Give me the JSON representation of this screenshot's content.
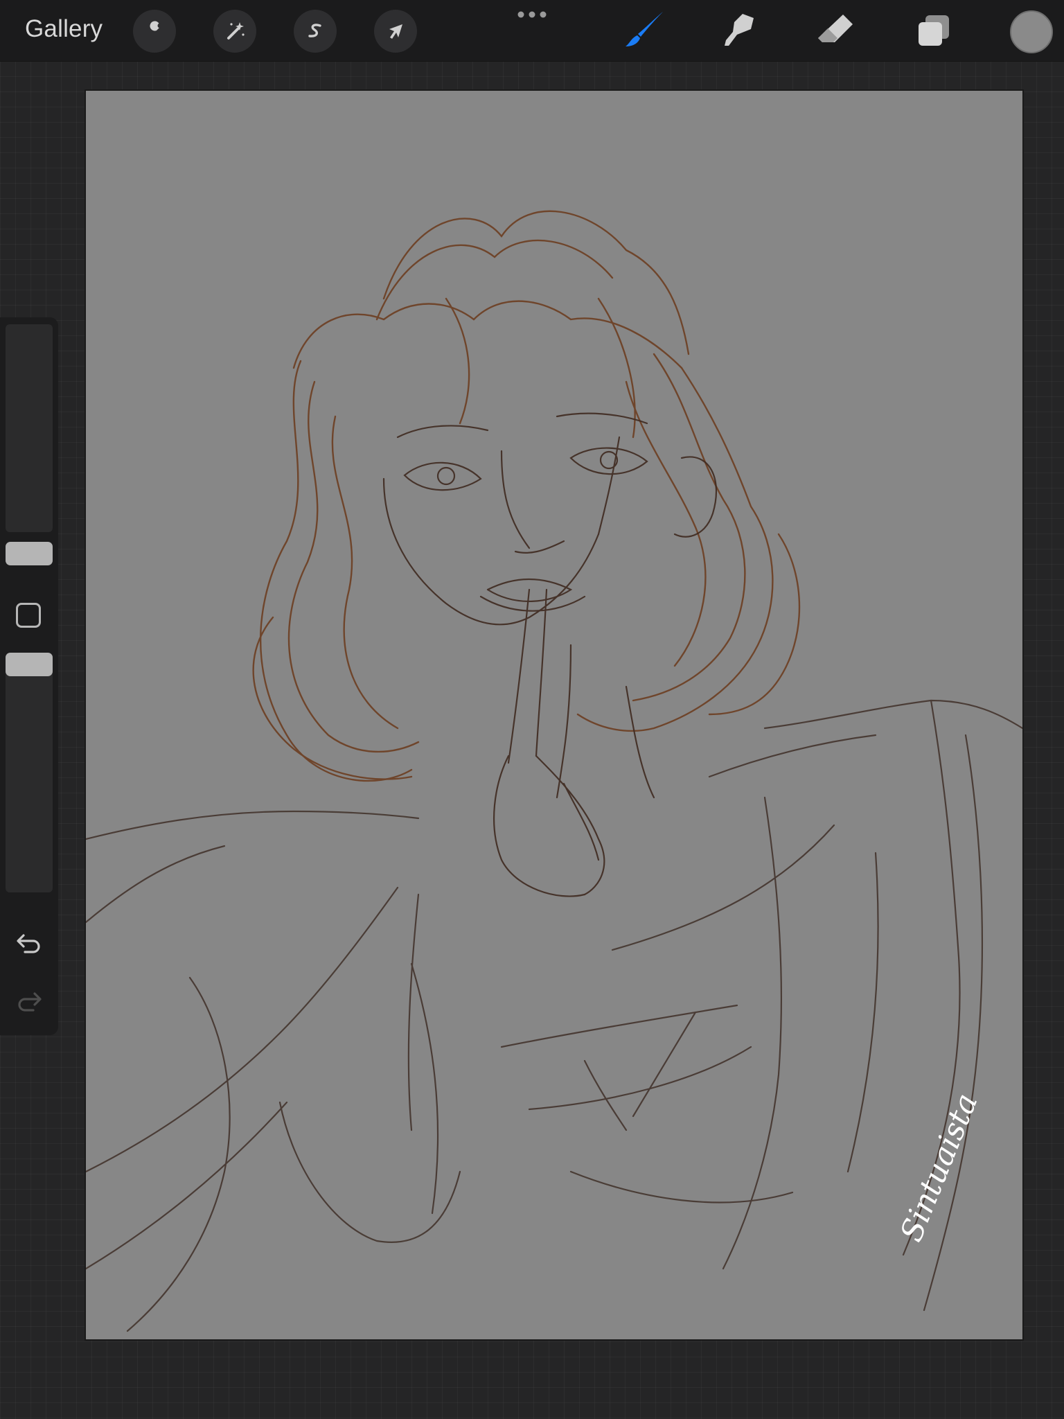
{
  "toolbar": {
    "gallery_label": "Gallery",
    "left_tools": [
      {
        "name": "actions",
        "icon": "wrench-icon"
      },
      {
        "name": "adjustments",
        "icon": "magic-wand-icon"
      },
      {
        "name": "selection",
        "icon": "selection-s-icon"
      },
      {
        "name": "transform",
        "icon": "arrow-cursor-icon"
      }
    ],
    "more_icon": "ellipsis-icon",
    "right_tools": [
      {
        "name": "brush",
        "icon": "brush-icon",
        "active": true
      },
      {
        "name": "smudge",
        "icon": "smudge-icon",
        "active": false
      },
      {
        "name": "eraser",
        "icon": "eraser-icon",
        "active": false
      },
      {
        "name": "layers",
        "icon": "layers-icon",
        "active": false
      }
    ],
    "current_color": "#8a8a8a",
    "active_tool_color": "#1a7cf5"
  },
  "sidebar": {
    "brush_size_level": 0.45,
    "opacity_level": 0.7,
    "modify_icon": "square-icon",
    "undo_icon": "undo-icon",
    "redo_icon": "redo-icon"
  },
  "canvas": {
    "background_color": "#878787",
    "stroke_color_warm": "#6b3a1c",
    "stroke_color_dark": "#3b2a22",
    "signature_text": "Sintuaista"
  }
}
